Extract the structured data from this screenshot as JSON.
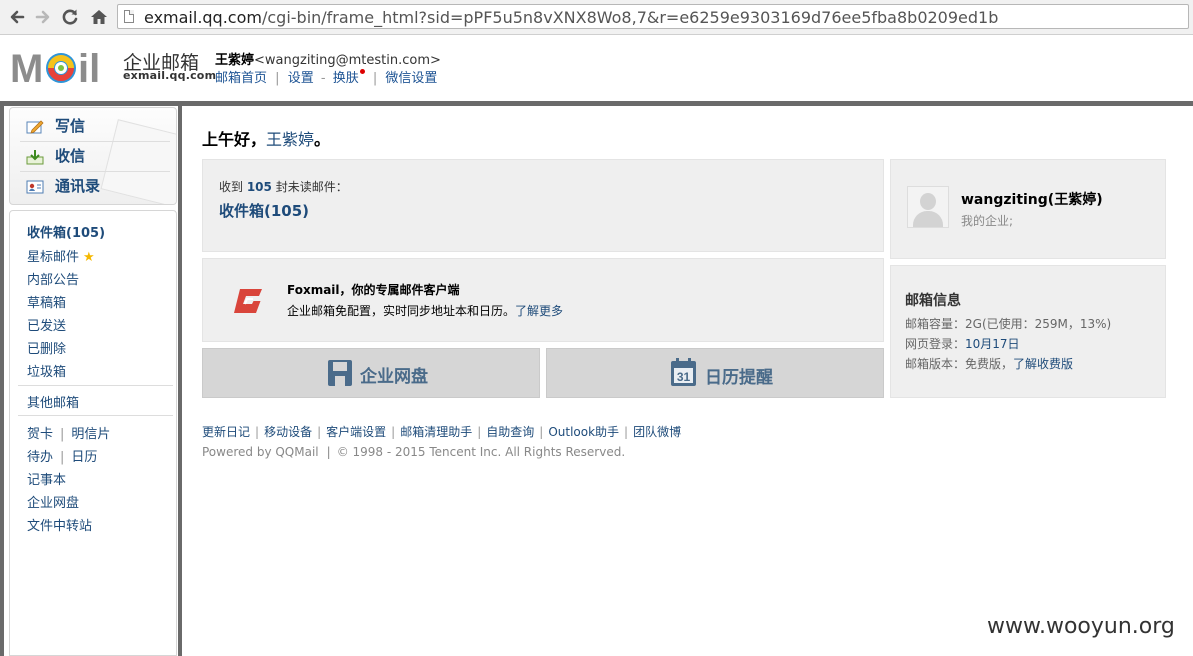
{
  "browser": {
    "url_host": "exmail.qq.com",
    "url_path": "/cgi-bin/frame_html?sid=pPF5u5n8vXNX8Wo8,7&r=e6259e9303169d76ee5fba8b0209ed1b"
  },
  "header": {
    "logo_text": "MOil",
    "brand_cn": "企业邮箱",
    "brand_en": "exmail.qq.com",
    "user_name": "王紫婷",
    "user_email": "<wangziting@mtestin.com>",
    "links": {
      "home": "邮箱首页",
      "settings": "设置",
      "dash": "-",
      "skin": "换肤",
      "wechat": "微信设置",
      "pipe": "|"
    }
  },
  "sidebar": {
    "quick": {
      "compose": "写信",
      "receive": "收信",
      "contacts": "通讯录"
    },
    "folders": {
      "inbox": "收件箱(105)",
      "starred": "星标邮件",
      "star_glyph": "★",
      "notice": "内部公告",
      "drafts": "草稿箱",
      "sent": "已发送",
      "deleted": "已删除",
      "spam": "垃圾箱",
      "other": "其他邮箱",
      "card": "贺卡",
      "postcard": "明信片",
      "todo": "待办",
      "calendar": "日历",
      "notes": "记事本",
      "disk": "企业网盘",
      "transfer": "文件中转站",
      "pipe": "|"
    }
  },
  "main": {
    "greeting_prefix": "上午好，",
    "greeting_name": "王紫婷",
    "greeting_suffix": "。",
    "unread": {
      "prefix": "收到 ",
      "count": "105",
      "suffix": " 封未读邮件：",
      "inbox_link": "收件箱(105)"
    },
    "foxmail": {
      "title": "Foxmail，你的专属邮件客户端",
      "desc": "企业邮箱免配置，实时同步地址本和日历。",
      "link": "了解更多"
    },
    "tiles": {
      "disk": "企业网盘",
      "calendar": "日历提醒",
      "calendar_day": "31"
    },
    "account": {
      "name": "wangziting(王紫婷)",
      "org": "我的企业;"
    },
    "mailbox_info": {
      "title": "邮箱信息",
      "capacity_label": "邮箱容量：",
      "capacity_value": "2G(已使用：259M，13%)",
      "login_label": "网页登录：",
      "login_value": "10月17日",
      "version_label": "邮箱版本：",
      "version_value": "免费版，",
      "version_link": "了解收费版"
    }
  },
  "footer": {
    "links": [
      "更新日记",
      "移动设备",
      "客户端设置",
      "邮箱清理助手",
      "自助查询",
      "Outlook助手",
      "团队微博"
    ],
    "pipe": "|",
    "powered": "Powered by QQMail",
    "copyright": "© 1998 - 2015 Tencent Inc. All Rights Reserved."
  },
  "watermark": "www.wooyun.org"
}
